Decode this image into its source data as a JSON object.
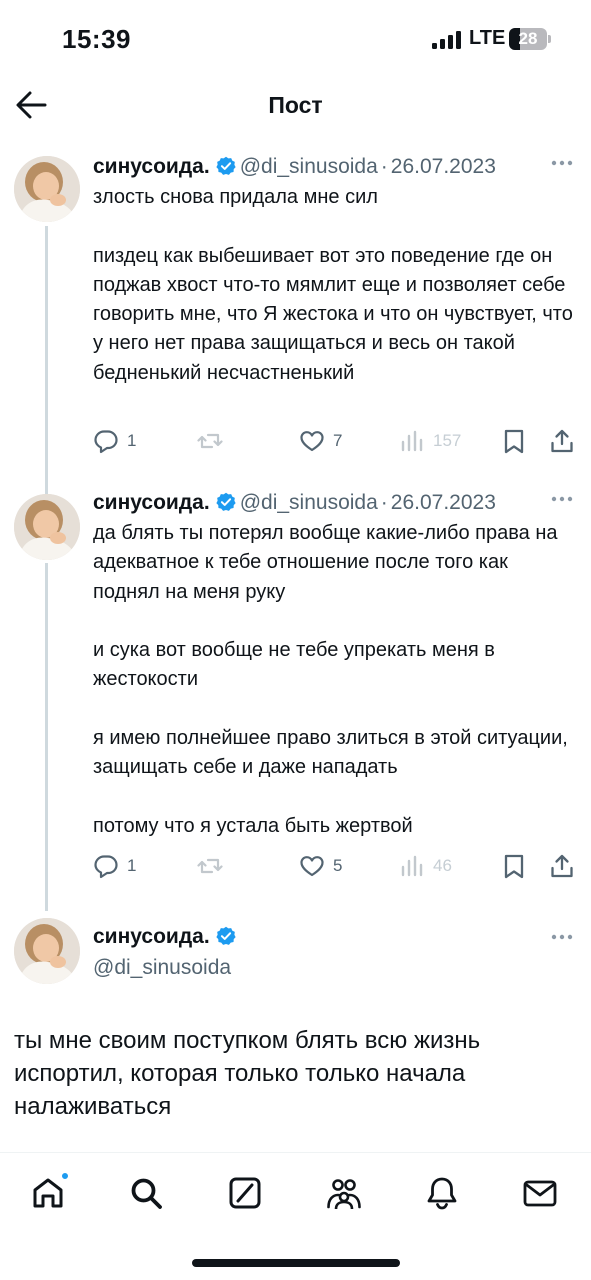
{
  "status_bar": {
    "time": "15:39",
    "network": "LTE",
    "battery": "28"
  },
  "header": {
    "title": "Пост"
  },
  "author": {
    "name": "синусоида.",
    "handle": "@di_sinusoida"
  },
  "tweets": [
    {
      "date": "26.07.2023",
      "text": "злость снова придала мне сил\n\nпиздец как выбешивает вот это поведение где он поджав хвост что-то мямлит еще и позволяет себе говорить мне, что Я жестока и что он чувствует, что у него нет права защищаться и весь он такой бедненький несчастненький",
      "replies": "1",
      "likes": "7",
      "views": "157"
    },
    {
      "date": "26.07.2023",
      "text": "да блять ты потерял вообще какие-либо права на адекватное к тебе отношение после того как поднял на меня руку\n\nи сука вот вообще не тебе упрекать меня в жестокости\n\nя имею полнейшее право злиться в этой ситуации, защищать себе и даже нападать\n\nпотому что я устала быть жертвой",
      "replies": "1",
      "likes": "5",
      "views": "46"
    }
  ],
  "main_tweet": {
    "text": "ты мне своим поступком блять всю жизнь испортил, которая только только начала налаживаться"
  },
  "tabs": [
    "home-icon",
    "search-icon",
    "grok-icon",
    "communities-icon",
    "notifications-icon",
    "messages-icon"
  ],
  "colors": {
    "accent": "#1d9bf0",
    "text": "#0f1419",
    "secondary": "#536471",
    "thread_line": "#cfd9de"
  }
}
